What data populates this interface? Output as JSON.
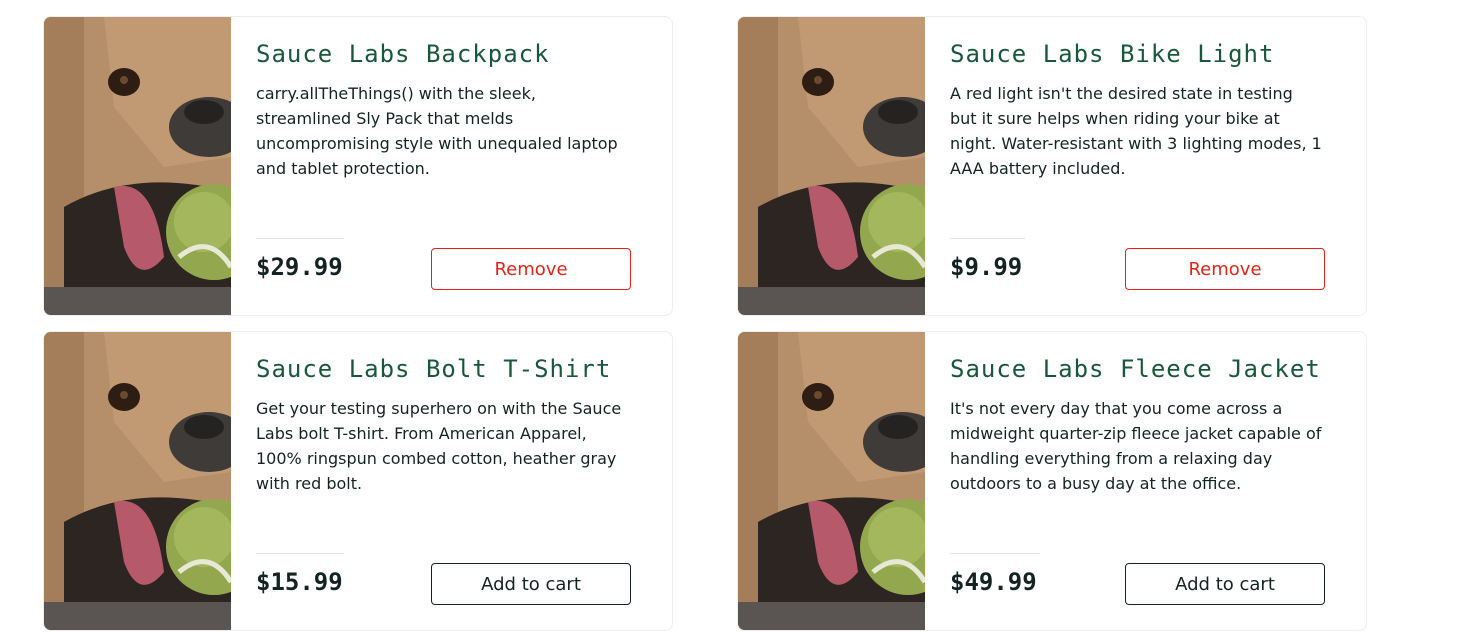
{
  "products": [
    {
      "name": "Sauce Labs Backpack",
      "description": "carry.allTheThings() with the sleek, streamlined Sly Pack that melds uncompromising style with unequaled laptop and tablet protection.",
      "price": "$29.99",
      "button_label": "Remove",
      "button_state": "remove",
      "image_icon": "dog-photo"
    },
    {
      "name": "Sauce Labs Bike Light",
      "description": "A red light isn't the desired state in testing but it sure helps when riding your bike at night. Water-resistant with 3 lighting modes, 1 AAA battery included.",
      "price": "$9.99",
      "button_label": "Remove",
      "button_state": "remove",
      "image_icon": "dog-photo"
    },
    {
      "name": "Sauce Labs Bolt T-Shirt",
      "description": "Get your testing superhero on with the Sauce Labs bolt T-shirt. From American Apparel, 100% ringspun combed cotton, heather gray with red bolt.",
      "price": "$15.99",
      "button_label": "Add to cart",
      "button_state": "add",
      "image_icon": "dog-photo"
    },
    {
      "name": "Sauce Labs Fleece Jacket",
      "description": "It's not every day that you come across a midweight quarter-zip fleece jacket capable of handling everything from a relaxing day outdoors to a busy day at the office.",
      "price": "$49.99",
      "button_label": "Add to cart",
      "button_state": "add",
      "image_icon": "dog-photo"
    }
  ],
  "colors": {
    "title": "#18583a",
    "text": "#132322",
    "remove": "#e2231a",
    "border": "#ededed"
  }
}
